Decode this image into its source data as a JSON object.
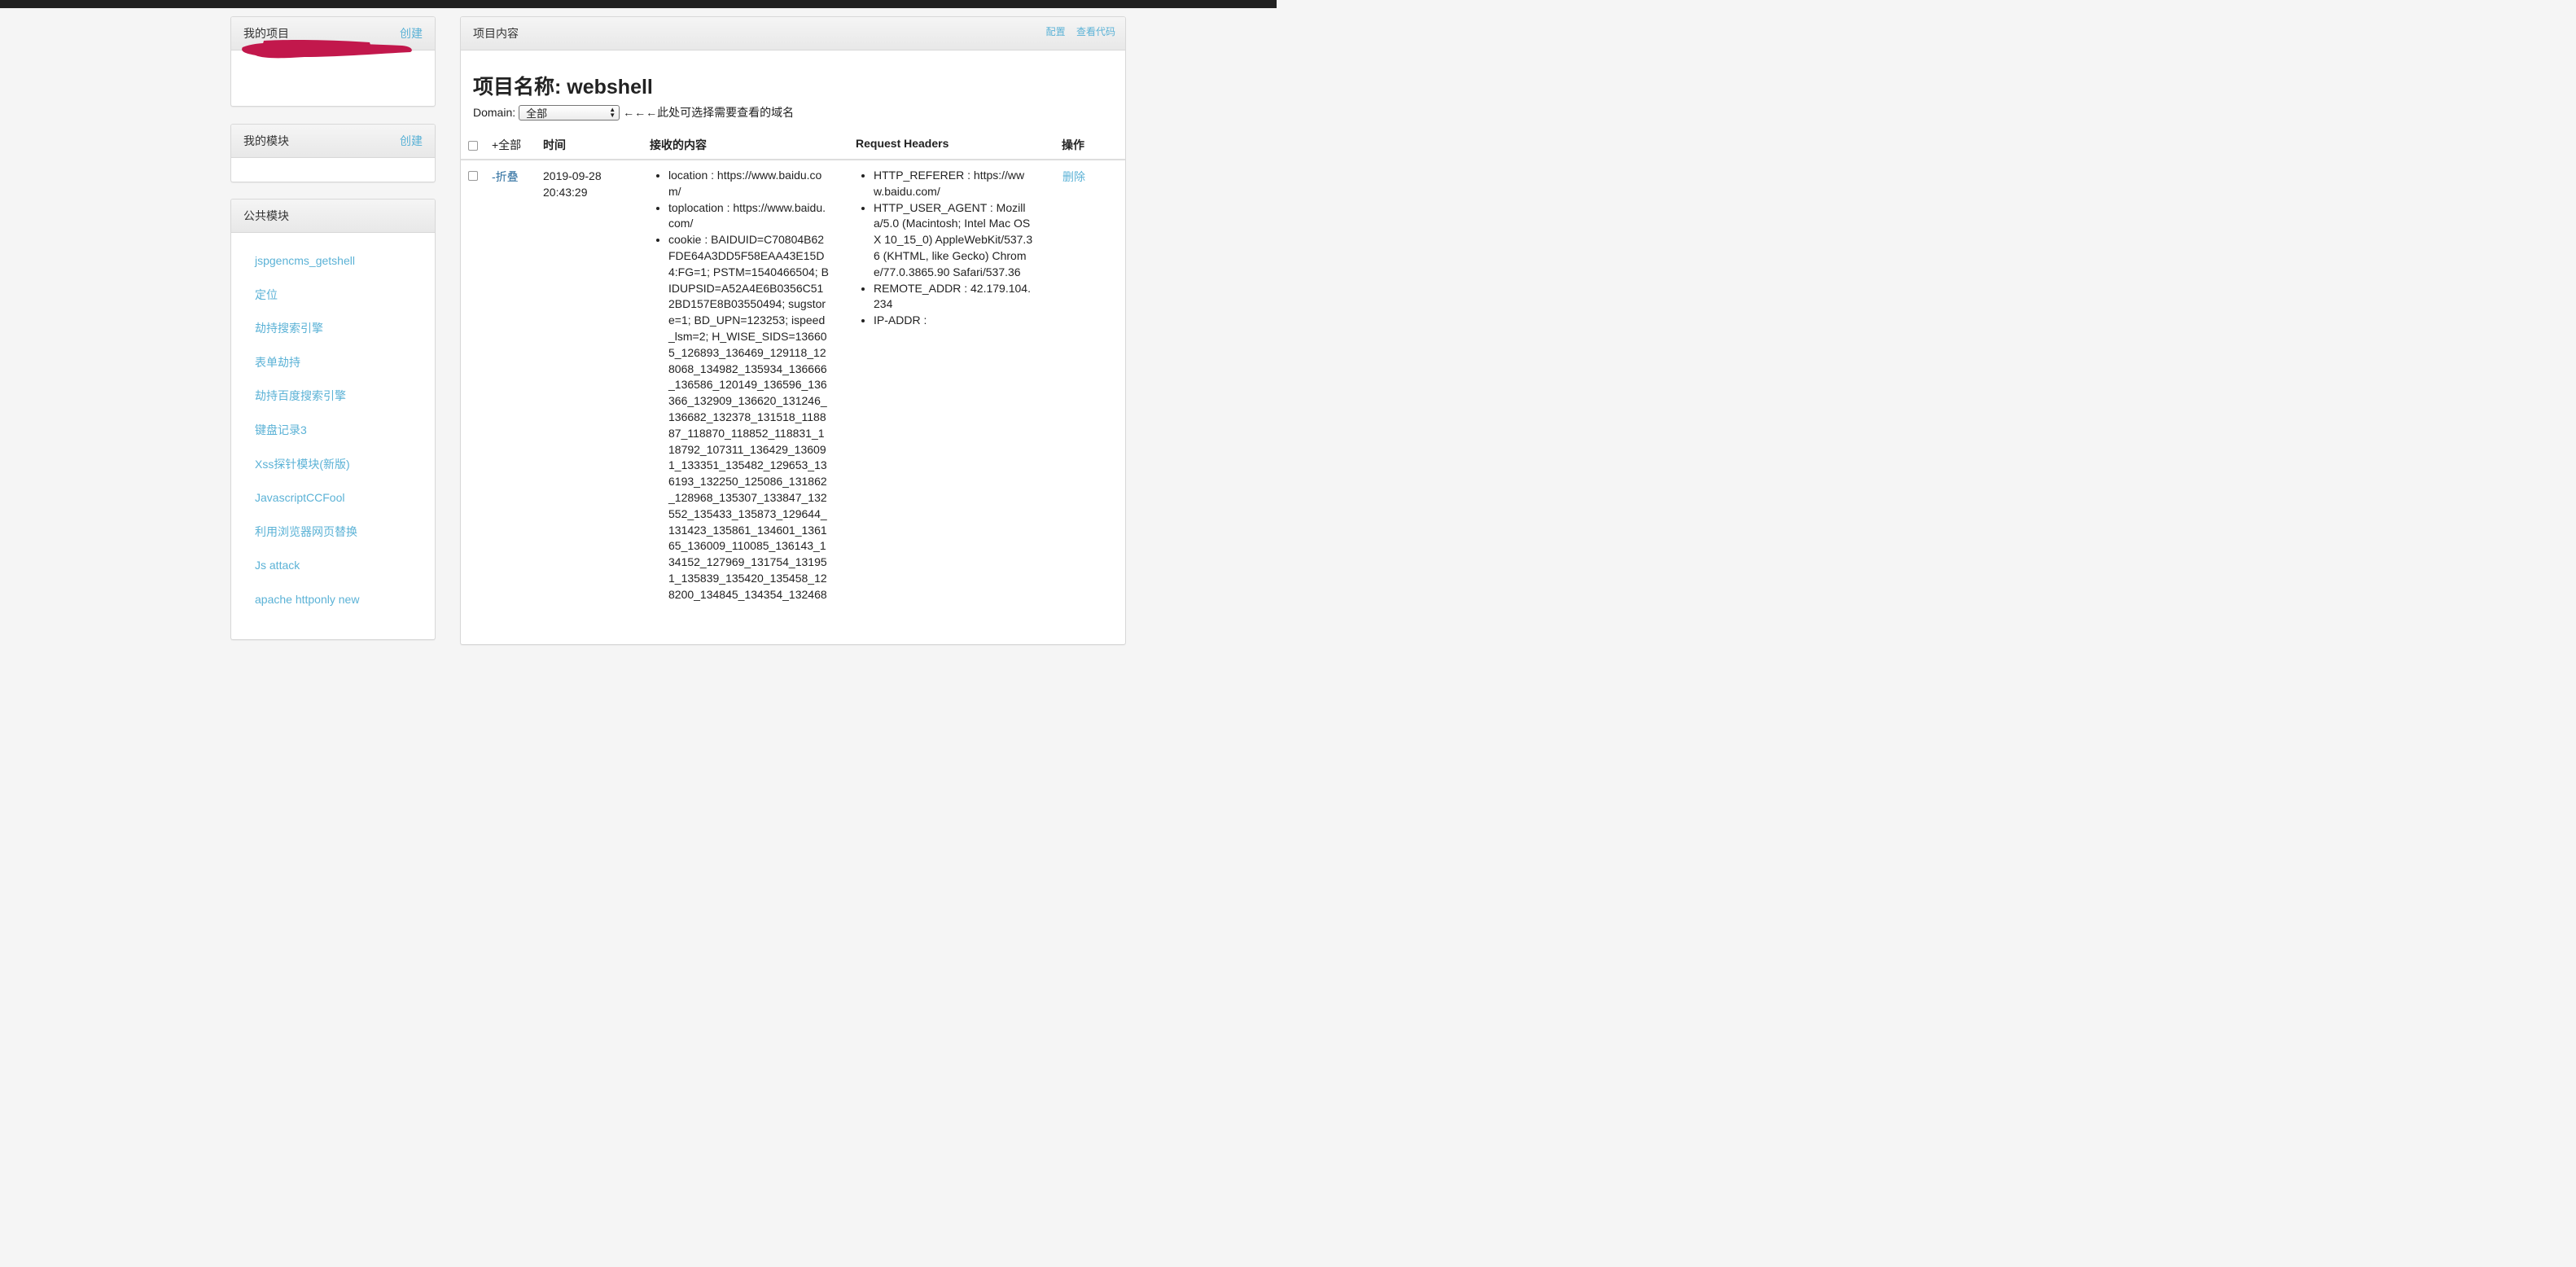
{
  "sidebar": {
    "projects": {
      "title": "我的项目",
      "create_label": "创建"
    },
    "modules": {
      "title": "我的模块",
      "create_label": "创建"
    },
    "public": {
      "title": "公共模块",
      "items": [
        "jspgencms_getshell",
        "定位",
        "劫持搜索引擎",
        "表单劫持",
        "劫持百度搜索引擎",
        "键盘记录3",
        "Xss探针模块(新版)",
        "JavascriptCCFool",
        "利用浏览器网页替换",
        "Js attack",
        "apache httponly new"
      ]
    }
  },
  "content": {
    "panel_title": "项目内容",
    "config_label": "配置",
    "view_code_label": "查看代码",
    "project_title": "项目名称: webshell",
    "domain_label": "Domain:",
    "domain_value": "全部",
    "domain_hint": "←←←此处可选择需要查看的域名",
    "table": {
      "headers": {
        "expand_all": "+全部",
        "time": "时间",
        "received": "接收的内容",
        "request_headers": "Request Headers",
        "actions": "操作"
      },
      "rows": [
        {
          "toggle": "-折叠",
          "time": "2019-09-28 20:43:29",
          "received": [
            "location : https://www.baidu.com/",
            "toplocation : https://www.baidu.com/",
            "cookie : BAIDUID=C70804B62FDE64A3DD5F58EAA43E15D4:FG=1; PSTM=1540466504; BIDUPSID=A52A4E6B0356C512BD157E8B03550494; sugstore=1; BD_UPN=123253; ispeed_lsm=2; H_WISE_SIDS=136605_126893_136469_129118_128068_134982_135934_136666_136586_120149_136596_136366_132909_136620_131246_136682_132378_131518_118887_118870_118852_118831_118792_107311_136429_136091_133351_135482_129653_136193_132250_125086_131862_128968_135307_133847_132552_135433_135873_129644_131423_135861_134601_136165_136009_110085_136143_134152_127969_131754_131951_135839_135420_135458_128200_134845_134354_132468"
          ],
          "headers": [
            "HTTP_REFERER : https://www.baidu.com/",
            "HTTP_USER_AGENT : Mozilla/5.0 (Macintosh; Intel Mac OS X 10_15_0) AppleWebKit/537.36 (KHTML, like Gecko) Chrome/77.0.3865.90 Safari/537.36",
            "REMOTE_ADDR : 42.179.104.234",
            "IP-ADDR :"
          ],
          "action": "删除"
        }
      ]
    }
  },
  "colors": {
    "link": "#5bb2d6",
    "redaction": "#c2184c"
  }
}
